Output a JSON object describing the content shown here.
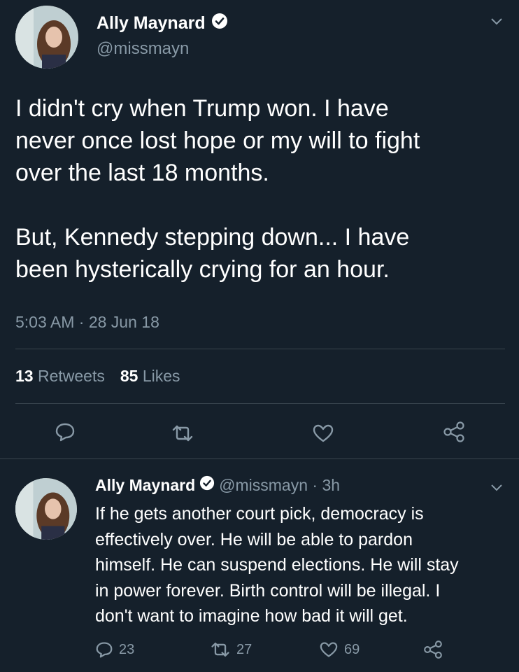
{
  "main_tweet": {
    "display_name": "Ally Maynard",
    "handle": "@missmayn",
    "paragraph_1_lines": [
      "I didn't cry when Trump won. I have",
      "never once lost hope or my will to fight",
      "over the last 18 months."
    ],
    "paragraph_2_lines": [
      "But, Kennedy stepping down... I have",
      "been hysterically crying for an hour."
    ],
    "timestamp": "5:03 AM · 28 Jun 18",
    "retweet_count": "13",
    "retweet_label": "Retweets",
    "like_count": "85",
    "like_label": "Likes"
  },
  "reply_tweet": {
    "display_name": "Ally Maynard",
    "handle_time": "@missmayn · 3h",
    "text_lines": [
      "If he gets another court pick, democracy is",
      "effectively over. He will be able to pardon",
      "himself. He can suspend elections. He will stay",
      "in power forever. Birth control will be illegal. I",
      "don't want to imagine how bad it will get."
    ],
    "reply_count": "23",
    "retweet_count": "27",
    "like_count": "69"
  },
  "icons": {
    "verified": "verified-badge-icon",
    "caret": "chevron-down-icon",
    "reply": "reply-icon",
    "retweet": "retweet-icon",
    "like": "heart-icon",
    "share": "share-icon"
  },
  "colors": {
    "background": "#15202b",
    "text": "#ffffff",
    "muted": "#8899a6",
    "divider": "#38444d"
  }
}
